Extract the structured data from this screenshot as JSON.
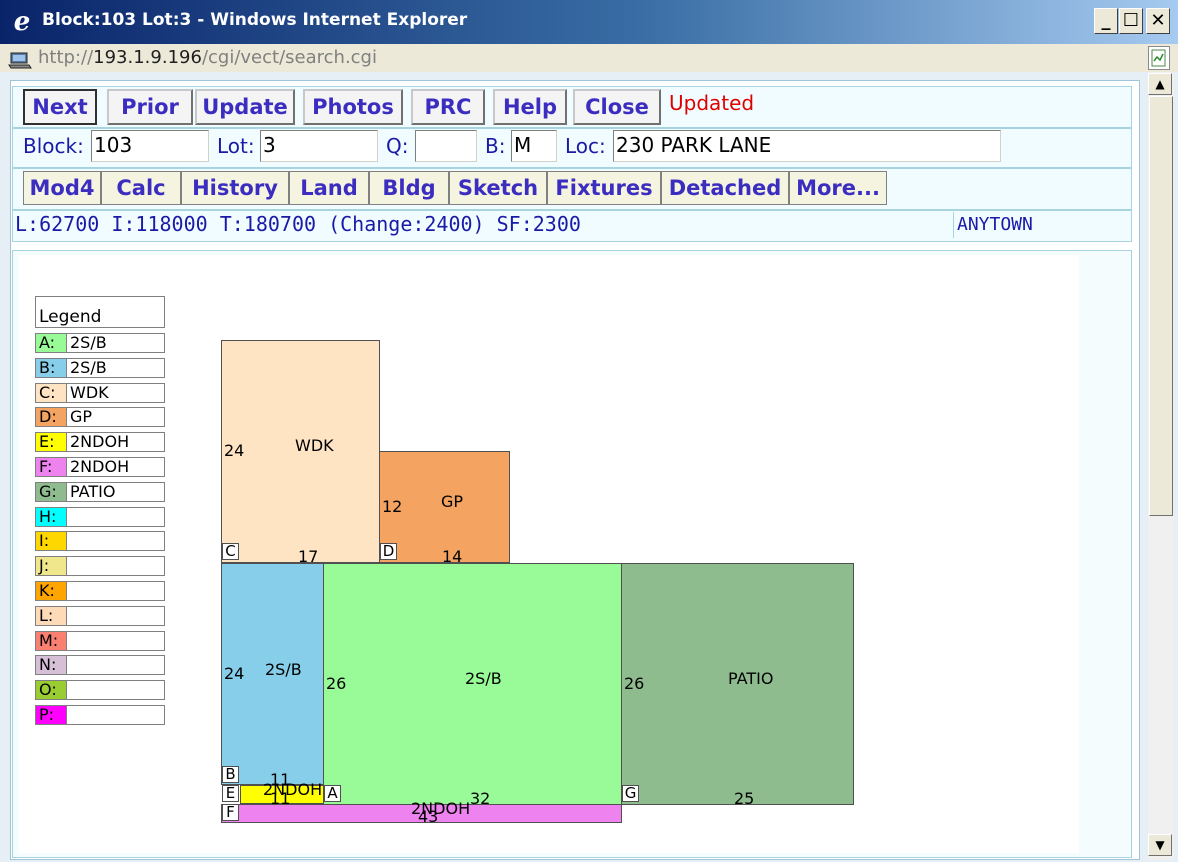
{
  "window": {
    "title": "Block:103 Lot:3 - Windows Internet Explorer",
    "minimize": "_",
    "maximize": "☐",
    "close": "✕",
    "logo": "e"
  },
  "address": {
    "prefix": "http://",
    "host": "193.1.9.196",
    "path": "/cgi/vect/search.cgi"
  },
  "toolbar": {
    "buttons": [
      "Next",
      "Prior",
      "Update",
      "Photos",
      "PRC",
      "Help",
      "Close"
    ],
    "status": "Updated"
  },
  "fields": {
    "block_label": "Block:",
    "block_value": "103",
    "lot_label": "Lot:",
    "lot_value": "3",
    "q_label": "Q:",
    "q_value": "",
    "b_label": "B:",
    "b_value": "M",
    "loc_label": "Loc:",
    "loc_value": "230 PARK LANE"
  },
  "tabs": [
    "Mod4",
    "Calc",
    "History",
    "Land",
    "Bldg",
    "Sketch",
    "Fixtures",
    "Detached",
    "More..."
  ],
  "summary": {
    "values": "L:62700 I:118000 T:180700 (Change:2400) SF:2300",
    "town": "ANYTOWN"
  },
  "legend": {
    "title": "Legend",
    "items": [
      {
        "key": "A:",
        "value": "2S/B",
        "color": "#98fb98"
      },
      {
        "key": "B:",
        "value": "2S/B",
        "color": "#87ceeb"
      },
      {
        "key": "C:",
        "value": "WDK",
        "color": "#ffe4c4"
      },
      {
        "key": "D:",
        "value": "GP",
        "color": "#f4a460"
      },
      {
        "key": "E:",
        "value": "2NDOH",
        "color": "#ffff00"
      },
      {
        "key": "F:",
        "value": "2NDOH",
        "color": "#ee82ee"
      },
      {
        "key": "G:",
        "value": "PATIO",
        "color": "#8fbc8f"
      },
      {
        "key": "H:",
        "value": "",
        "color": "#00ffff"
      },
      {
        "key": "I:",
        "value": "",
        "color": "#ffd700"
      },
      {
        "key": "J:",
        "value": "",
        "color": "#f0e68c"
      },
      {
        "key": "K:",
        "value": "",
        "color": "#ffa500"
      },
      {
        "key": "L:",
        "value": "",
        "color": "#ffdab9"
      },
      {
        "key": "M:",
        "value": "",
        "color": "#fa8072"
      },
      {
        "key": "N:",
        "value": "",
        "color": "#d8bfd8"
      },
      {
        "key": "O:",
        "value": "",
        "color": "#9acd32"
      },
      {
        "key": "P:",
        "value": "",
        "color": "#ff00ff"
      }
    ]
  },
  "sketch": {
    "areas": [
      {
        "id": "C",
        "name": "WDK",
        "depth": "24",
        "width": "17",
        "color": "#ffe4c4"
      },
      {
        "id": "D",
        "name": "GP",
        "depth": "12",
        "width": "14",
        "color": "#f4a460"
      },
      {
        "id": "B",
        "name": "2S/B",
        "depth": "24",
        "width": "11",
        "color": "#87ceeb"
      },
      {
        "id": "A",
        "name": "2S/B",
        "depth": "26",
        "width": "32",
        "color": "#98fb98"
      },
      {
        "id": "G",
        "name": "PATIO",
        "depth": "26",
        "width": "25",
        "color": "#8fbc8f"
      },
      {
        "id": "E",
        "name": "2NDOH",
        "depth": "",
        "width": "11",
        "color": "#ffff00"
      },
      {
        "id": "F",
        "name": "2NDOH",
        "depth": "",
        "width": "43",
        "color": "#ee82ee"
      }
    ]
  }
}
